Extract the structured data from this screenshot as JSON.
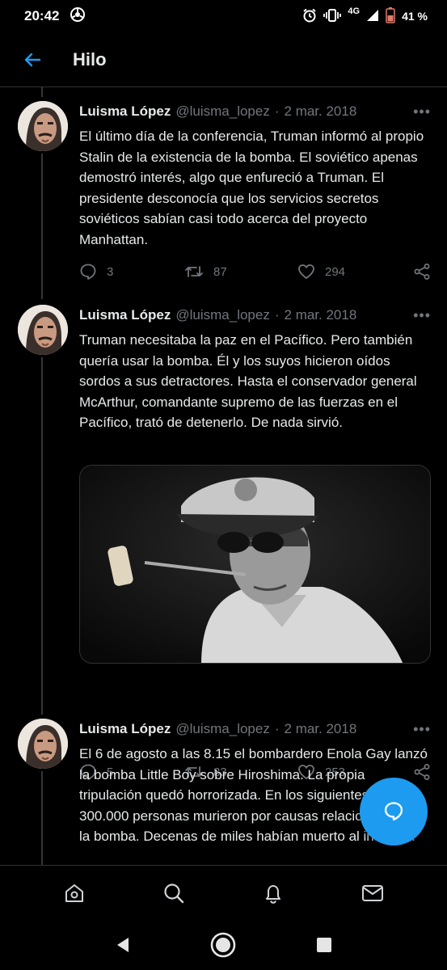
{
  "status_bar": {
    "time": "20:42",
    "network": "4G",
    "battery": "41 %",
    "icons": [
      "chrome-icon",
      "alarm-icon",
      "vibrate-icon",
      "signal-icon",
      "battery-icon"
    ]
  },
  "header": {
    "title": "Hilo",
    "back_icon": "arrow-left-icon"
  },
  "tweets": [
    {
      "name": "Luisma López",
      "handle": "@luisma_lopez",
      "sep": "·",
      "date": "2 mar. 2018",
      "more": "•••",
      "text": "El último día de la conferencia, Truman informó al propio Stalin de la existencia de la bomba. El soviético apenas demostró interés, algo que enfureció a Truman. El presidente desconocía que los servicios secretos soviéticos sabían casi todo acerca del proyecto Manhattan.",
      "replies": "3",
      "retweets": "87",
      "likes": "294"
    },
    {
      "name": "Luisma López",
      "handle": "@luisma_lopez",
      "sep": "·",
      "date": "2 mar. 2018",
      "more": "•••",
      "text": "Truman necesitaba la paz en el Pacífico. Pero también quería usar la bomba. Él y los suyos hicieron oídos sordos a sus detractores. Hasta el conservador general McArthur, comandante supremo de las fuerzas en el Pacífico, trató de detenerlo. De nada sirvió.",
      "replies": "5",
      "retweets": "83",
      "likes": "253"
    },
    {
      "name": "Luisma López",
      "handle": "@luisma_lopez",
      "sep": "·",
      "date": "2 mar. 2018",
      "more": "•••",
      "text": "El 6 de agosto a las 8.15 el bombardero Enola Gay lanzó la bomba Little Boy sobre Hiroshima. La propia tripulación quedó horrorizada. En los siguientes más de 300.000 personas murieron por causas relacionadas con la bomba. Decenas de miles habían muerto al instante."
    }
  ],
  "colors": {
    "accent": "#1d9bf0",
    "background": "#000000",
    "muted": "#71767b",
    "text": "#e7e9ea"
  },
  "bottom_nav": [
    "home-icon",
    "search-icon",
    "notifications-icon",
    "messages-icon"
  ],
  "system_nav": [
    "back-triangle-icon",
    "home-circle-icon",
    "recents-square-icon"
  ]
}
